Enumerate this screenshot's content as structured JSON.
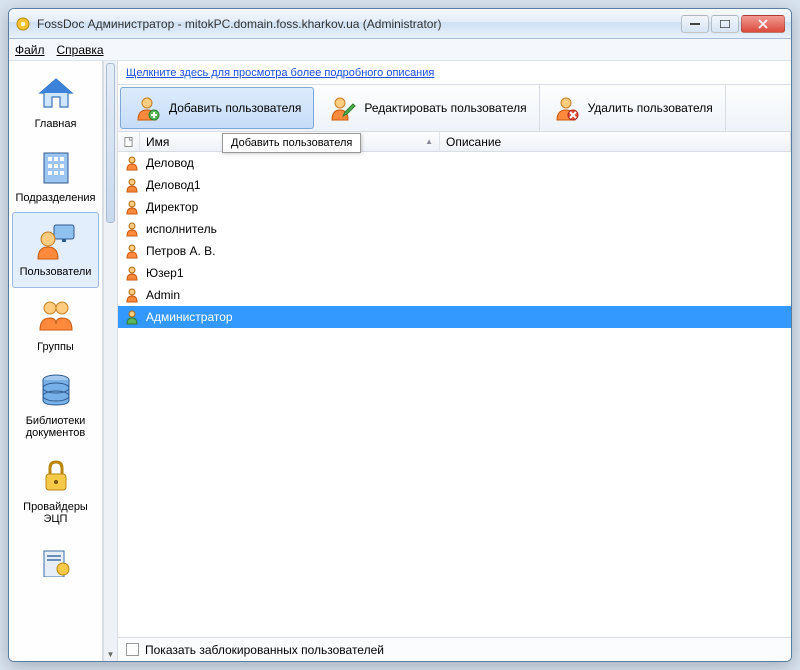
{
  "window": {
    "title": "FossDoc Администратор - mitokPC.domain.foss.kharkov.ua (Administrator)"
  },
  "menus": {
    "file": "Файл",
    "help": "Справка"
  },
  "sidebar": {
    "items": [
      {
        "label": "Главная"
      },
      {
        "label": "Подразделения"
      },
      {
        "label": "Пользователи"
      },
      {
        "label": "Группы"
      },
      {
        "label": "Библиотеки документов"
      },
      {
        "label": "Провайдеры ЭЦП"
      }
    ]
  },
  "main": {
    "info_link": "Щелкните здесь для просмотра более подробного описания",
    "toolbar": {
      "add": "Добавить пользователя",
      "edit": "Редактировать пользователя",
      "delete": "Удалить пользователя"
    },
    "columns": {
      "name": "Имя",
      "desc": "Описание"
    },
    "rows": [
      {
        "name": "Деловод"
      },
      {
        "name": "Деловод1"
      },
      {
        "name": "Директор"
      },
      {
        "name": "исполнитель"
      },
      {
        "name": "Петров А. В."
      },
      {
        "name": "Юзер1"
      },
      {
        "name": "Admin"
      },
      {
        "name": "Администратор"
      }
    ],
    "tooltip": "Добавить пользователя",
    "status_checkbox": "Показать заблокированных пользователей"
  }
}
